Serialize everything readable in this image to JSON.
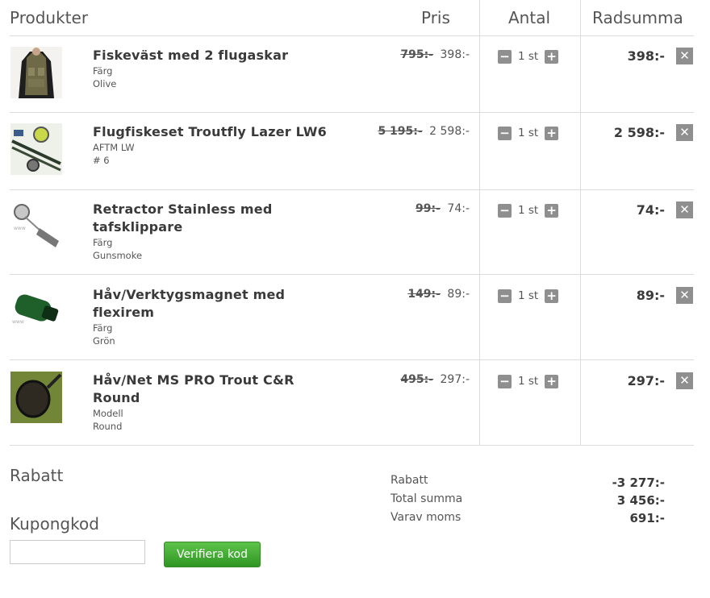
{
  "header": {
    "products": "Produkter",
    "price": "Pris",
    "quantity": "Antal",
    "row_sum": "Radsumma"
  },
  "items": [
    {
      "name_lines": [
        "Fiskeväst med 2 flugaskar"
      ],
      "option_label": "Färg",
      "option_value": "Olive",
      "old_price": "795:-",
      "price": "398:-",
      "qty": "1 st",
      "row_sum": "398:-",
      "thumb_icon": "vest-icon"
    },
    {
      "name_lines": [
        "Flugfiskeset Troutfly Lazer LW6"
      ],
      "option_label": "AFTM LW",
      "option_value": "# 6",
      "old_price": "5 195:-",
      "price": "2 598:-",
      "qty": "1 st",
      "row_sum": "2 598:-",
      "thumb_icon": "fly-rod-set-icon"
    },
    {
      "name_lines": [
        "Retractor Stainless med",
        "tafsklippare"
      ],
      "option_label": "Färg",
      "option_value": "Gunsmoke",
      "old_price": "99:-",
      "price": "74:-",
      "qty": "1 st",
      "row_sum": "74:-",
      "thumb_icon": "retractor-icon"
    },
    {
      "name_lines": [
        "Håv/Verktygsmagnet med",
        "flexirem"
      ],
      "option_label": "Färg",
      "option_value": "Grön",
      "old_price": "149:-",
      "price": "89:-",
      "qty": "1 st",
      "row_sum": "89:-",
      "thumb_icon": "magnet-icon"
    },
    {
      "name_lines": [
        "Håv/Net MS PRO Trout C&R",
        "Round"
      ],
      "option_label": "Modell",
      "option_value": "Round",
      "old_price": "495:-",
      "price": "297:-",
      "qty": "1 st",
      "row_sum": "297:-",
      "thumb_icon": "landing-net-icon"
    }
  ],
  "icons": {
    "minus": "−",
    "plus": "+",
    "remove": "✕"
  },
  "discount": {
    "title": "Rabatt",
    "coupon_title": "Kupongkod",
    "coupon_value": "",
    "coupon_placeholder": "",
    "verify_label": "Verifiera kod"
  },
  "totals": {
    "discount_label": "Rabatt",
    "discount_value": "-3 277:-",
    "total_label": "Total summa",
    "total_value": "3 456:-",
    "vat_label": "Varav moms",
    "vat_value": "691:-"
  },
  "colors": {
    "button_green": "#2f9623",
    "icon_grey": "#8f8f8f"
  }
}
